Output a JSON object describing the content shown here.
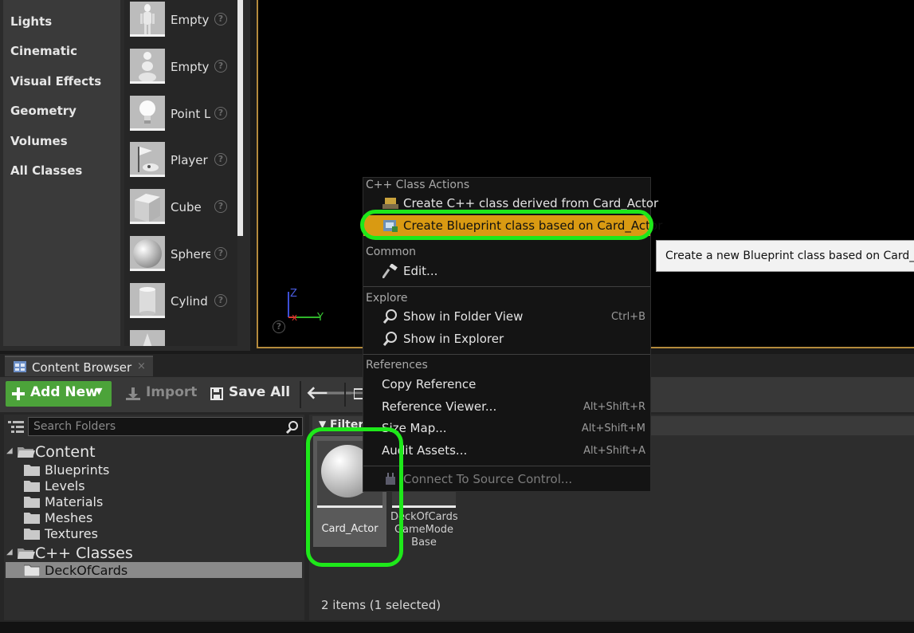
{
  "place_actors": {
    "categories": [
      "Lights",
      "Cinematic",
      "Visual Effects",
      "Geometry",
      "Volumes",
      "All Classes"
    ],
    "items": [
      "Empty",
      "Empty",
      "Point L",
      "Player",
      "Cube",
      "Sphere",
      "Cylind"
    ]
  },
  "viewport": {
    "axis_z": "Z",
    "axis_y": "Y"
  },
  "content_browser": {
    "tab_label": "Content Browser",
    "toolbar": {
      "add_new": "Add New",
      "import": "Import",
      "save_all": "Save All"
    },
    "search_placeholder": "Search Folders",
    "filters_label": "Filters",
    "tree": {
      "content": "Content",
      "folders": [
        "Blueprints",
        "Levels",
        "Materials",
        "Meshes",
        "Textures"
      ],
      "cpp_classes": "C++ Classes",
      "selected_folder": "DeckOfCards"
    },
    "assets": [
      {
        "name": "Card_Actor"
      },
      {
        "name_lines": [
          "DeckOfCards",
          "GameMode",
          "Base"
        ]
      }
    ],
    "status": "2 items (1 selected)"
  },
  "context_menu": {
    "sections": {
      "cpp": "C++ Class Actions",
      "common": "Common",
      "explore": "Explore",
      "references": "References"
    },
    "items": {
      "create_cpp": "Create C++ class derived from Card_Actor",
      "create_bp": "Create Blueprint class based on Card_Actor",
      "edit": "Edit...",
      "show_folder": "Show in Folder View",
      "show_folder_key": "Ctrl+B",
      "show_explorer": "Show in Explorer",
      "copy_ref": "Copy Reference",
      "ref_viewer": "Reference Viewer...",
      "ref_viewer_key": "Alt+Shift+R",
      "size_map": "Size Map...",
      "size_map_key": "Alt+Shift+M",
      "audit": "Audit Assets...",
      "audit_key": "Alt+Shift+A",
      "source_control": "Connect To Source Control..."
    }
  },
  "tooltip": "Create a new Blueprint class based on Card_Actor",
  "colors": {
    "highlight": "#d99a12",
    "annotation_ring": "#1ee81a",
    "add_new_button": "#4ca33a",
    "viewport_border": "#b48a3c"
  }
}
